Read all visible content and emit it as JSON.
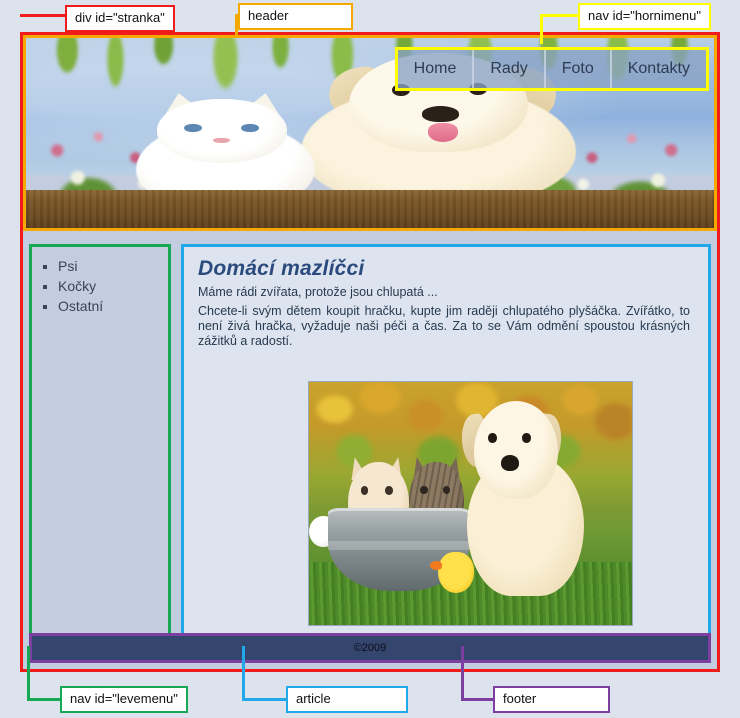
{
  "annotations": {
    "stranka": {
      "label": "div id=\"stranka\"",
      "color": "#f01c1c"
    },
    "header": {
      "label": "header",
      "color": "#f5a800"
    },
    "hornimenu": {
      "label": "nav id=\"hornimenu\"",
      "color": "#ffff00"
    },
    "levemenu": {
      "label": "nav id=\"levemenu\"",
      "color": "#16a855"
    },
    "article": {
      "label": "article",
      "color": "#20a8e8"
    },
    "footer": {
      "label": "footer",
      "color": "#7c3fa0"
    }
  },
  "topnav": {
    "items": [
      {
        "label": "Home"
      },
      {
        "label": "Rady"
      },
      {
        "label": "Foto"
      },
      {
        "label": "Kontakty"
      }
    ]
  },
  "sidebar": {
    "items": [
      {
        "label": "Psi"
      },
      {
        "label": "Kočky"
      },
      {
        "label": "Ostatní"
      }
    ]
  },
  "article": {
    "heading": "Domácí mazlíčci",
    "intro": "Máme rádi zvířata, protože jsou chlupatá ...",
    "body": "Chcete-li svým  dětem koupit hračku, kupte  jim raději chlupatého plyšáčka. Zvířátko, to  není živá  hračka,  vyžaduje  naši  péči  a  čas.  Za  to  se  Vám  odmění  spoustou krásných zážitků a radostí.",
    "image_alt": "two-kittens-in-tub-with-puppy-photo"
  },
  "header": {
    "image_alt": "kitten-and-puppy-header-photo"
  },
  "footer": {
    "copyright": "©2009"
  }
}
